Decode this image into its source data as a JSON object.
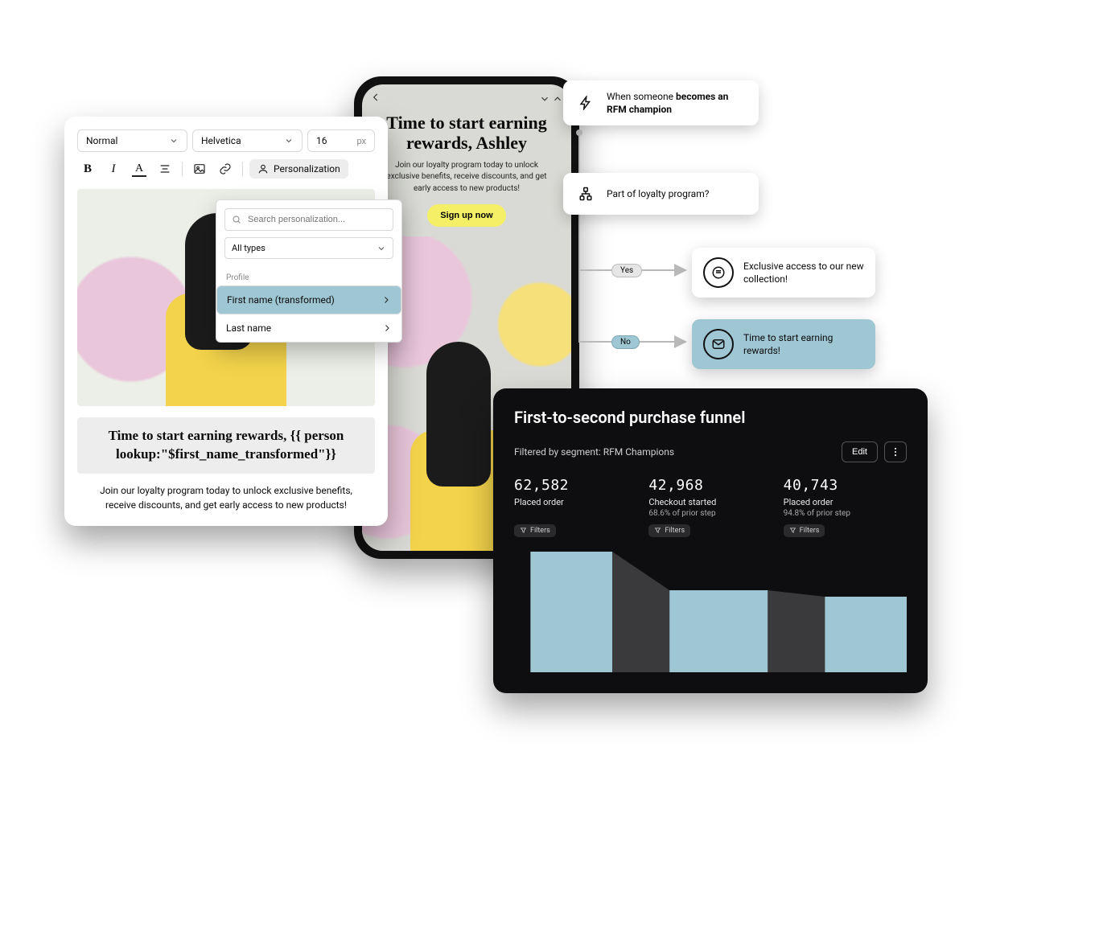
{
  "editor": {
    "style_select": "Normal",
    "font_select": "Helvetica",
    "size_value": "16",
    "size_unit": "px",
    "personalization_label": "Personalization",
    "headline": "Time to start earning rewards, {{ person lookup:\"$first_name_transformed\"}}",
    "body": "Join our loyalty program today to unlock exclusive benefits, receive discounts, and get early access to new products!"
  },
  "personalization": {
    "search_placeholder": "Search personalization...",
    "types_select": "All types",
    "group": "Profile",
    "options": [
      {
        "label": "First name (transformed)",
        "selected": true
      },
      {
        "label": "Last name",
        "selected": false
      }
    ]
  },
  "phone": {
    "headline": "Time to start earning rewards, Ashley",
    "body": "Join our loyalty program today to unlock exclusive benefits, receive discounts, and get early access to new products!",
    "cta": "Sign up now"
  },
  "flow": {
    "trigger_prefix": "When someone ",
    "trigger_bold": "becomes an RFM champion",
    "condition": "Part of loyalty program?",
    "yes": "Yes",
    "no": "No",
    "msg_yes": "Exclusive access to our new collection!",
    "msg_no": "Time to start earning rewards!"
  },
  "funnel": {
    "title": "First-to-second purchase funnel",
    "filter_label": "Filtered by segment: RFM Champions",
    "edit": "Edit",
    "filters_chip": "Filters",
    "steps": [
      {
        "value": "62,582",
        "label": "Placed order",
        "pct": ""
      },
      {
        "value": "42,968",
        "label": "Checkout started",
        "pct": "68.6% of prior step"
      },
      {
        "value": "40,743",
        "label": "Placed order",
        "pct": "94.8% of prior step"
      }
    ]
  },
  "chart_data": {
    "type": "bar",
    "title": "First-to-second purchase funnel",
    "categories": [
      "Placed order",
      "Checkout started",
      "Placed order"
    ],
    "values": [
      62582,
      42968,
      40743
    ],
    "pct_of_prior": [
      null,
      68.6,
      94.8
    ],
    "xlabel": "",
    "ylabel": "",
    "ylim": [
      0,
      62582
    ]
  }
}
